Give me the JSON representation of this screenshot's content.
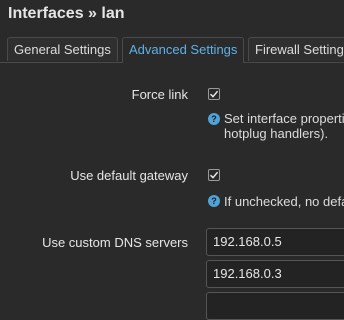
{
  "page": {
    "title": "Interfaces » lan"
  },
  "tabs": [
    {
      "label": "General Settings"
    },
    {
      "label": "Advanced Settings"
    },
    {
      "label": "Firewall Settings"
    }
  ],
  "fields": {
    "force_link": {
      "label": "Force link",
      "checked": true,
      "help_line1": "Set interface properti",
      "help_line2": "hotplug handlers)."
    },
    "default_gateway": {
      "label": "Use default gateway",
      "checked": true,
      "help_line1": "If unchecked, no defa"
    },
    "custom_dns": {
      "label": "Use custom DNS servers",
      "values": [
        "192.168.0.5",
        "192.168.0.3"
      ]
    }
  },
  "colors": {
    "accent": "#5eb1e6",
    "help_icon": "#4fa3d6",
    "background": "#2a2a2a"
  },
  "icons": {
    "help": "help-icon",
    "check": "checkmark-icon"
  }
}
